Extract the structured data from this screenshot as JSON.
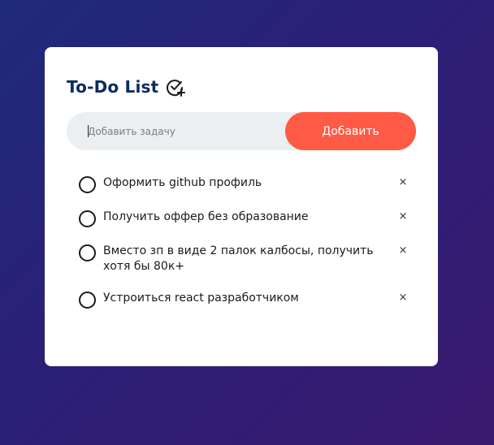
{
  "app": {
    "title": "To-Do List",
    "title_icon": "check-circle-plus-icon"
  },
  "new_task": {
    "placeholder": "Добавить задачу",
    "value": "",
    "add_label": "Добавить"
  },
  "tasks": [
    {
      "text": "Оформить github профиль",
      "done": false,
      "delete_label": "×"
    },
    {
      "text": "Получить оффер без образование",
      "done": false,
      "delete_label": "×"
    },
    {
      "text": "Вместо зп в виде 2 палок калбосы, получить хотя бы 80к+",
      "done": false,
      "delete_label": "×"
    },
    {
      "text": "Устроиться react разработчиком",
      "done": false,
      "delete_label": "×"
    }
  ],
  "colors": {
    "background_start": "#1f2a7a",
    "background_end": "#3a1a6e",
    "title": "#0b2b63",
    "accent_button": "#ff5a45",
    "input_bg": "#eceff1"
  }
}
